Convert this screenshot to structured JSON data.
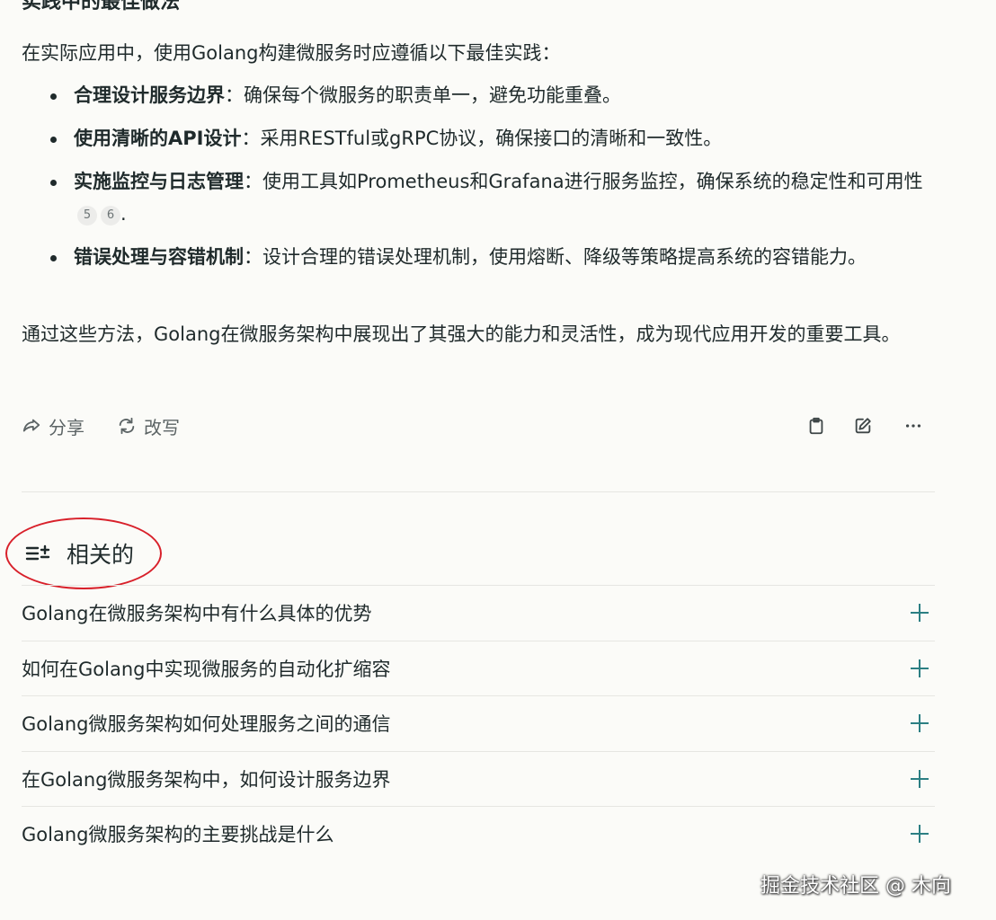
{
  "section": {
    "heading": "实践中的最佳做法",
    "intro": "在实际应用中，使用Golang构建微服务时应遵循以下最佳实践："
  },
  "practices": [
    {
      "title": "合理设计服务边界",
      "text": "：确保每个微服务的职责单一，避免功能重叠。",
      "cites": []
    },
    {
      "title": "使用清晰的API设计",
      "text": "：采用RESTful或gRPC协议，确保接口的清晰和一致性。",
      "cites": []
    },
    {
      "title": "实施监控与日志管理",
      "text": "：使用工具如Prometheus和Grafana进行服务监控，确保系统的稳定性和可用性",
      "cites": [
        "5",
        "6"
      ],
      "tail": "."
    },
    {
      "title": "错误处理与容错机制",
      "text": "：设计合理的错误处理机制，使用熔断、降级等策略提高系统的容错能力。",
      "cites": []
    }
  ],
  "conclusion": "通过这些方法，Golang在微服务架构中展现出了其强大的能力和灵活性，成为现代应用开发的重要工具。",
  "actions": {
    "share_label": "分享",
    "rewrite_label": "改写",
    "icons": [
      "copy-icon",
      "edit-icon",
      "more-icon"
    ]
  },
  "related": {
    "title": "相关的",
    "items": [
      "Golang在微服务架构中有什么具体的优势",
      "如何在Golang中实现微服务的自动化扩缩容",
      "Golang微服务架构如何处理服务之间的通信",
      "在Golang微服务架构中，如何设计服务边界",
      "Golang微服务架构的主要挑战是什么"
    ]
  },
  "watermark": "掘金技术社区 @ 木向",
  "colors": {
    "background": "#fbfbf8",
    "text": "#1f2a2b",
    "accent_plus": "#2c7f83",
    "annotation_circle": "#d8202a"
  }
}
